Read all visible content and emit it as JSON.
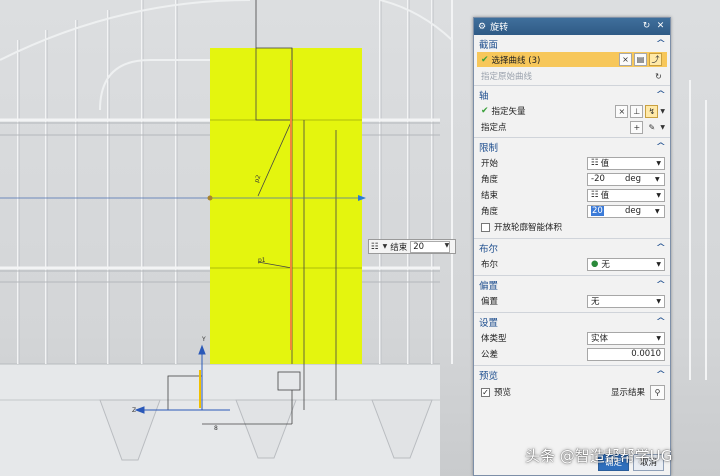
{
  "dialog": {
    "title": "旋转",
    "sections": {
      "section": {
        "title": "截面",
        "select_curve": "选择曲线 (3)",
        "specify_origin": "指定原始曲线"
      },
      "axis": {
        "title": "轴",
        "specify_vector": "指定矢量",
        "specify_point": "指定点"
      },
      "limits": {
        "title": "限制",
        "start_label": "开始",
        "start_type": "值",
        "start_angle_label": "角度",
        "start_angle": "-20",
        "start_unit": "deg",
        "end_label": "结束",
        "end_type": "值",
        "end_angle_label": "角度",
        "end_angle": "20",
        "end_unit": "deg",
        "open_profile": "开放轮廓智能体积"
      },
      "boolean": {
        "title": "布尔",
        "label": "布尔",
        "value": "无"
      },
      "offset": {
        "title": "偏置",
        "label": "偏置",
        "value": "无"
      },
      "settings": {
        "title": "设置",
        "body_type_label": "体类型",
        "body_type": "实体",
        "tolerance_label": "公差",
        "tolerance": "0.0010"
      },
      "preview": {
        "title": "预览",
        "preview_label": "预览",
        "show_result": "显示结果"
      }
    },
    "buttons": {
      "ok": "确定",
      "cancel": "取消"
    }
  },
  "viewport": {
    "onscreen_end_label": "结束",
    "onscreen_end_value": "20",
    "onscreen_type": "值"
  },
  "watermark": "头条 @智造帮帮学UG",
  "colors": {
    "preview_body": "#e4f50e",
    "title_bar": "#2f5a85",
    "selection": "#f7c75a",
    "section_header": "#1f4f8f"
  }
}
